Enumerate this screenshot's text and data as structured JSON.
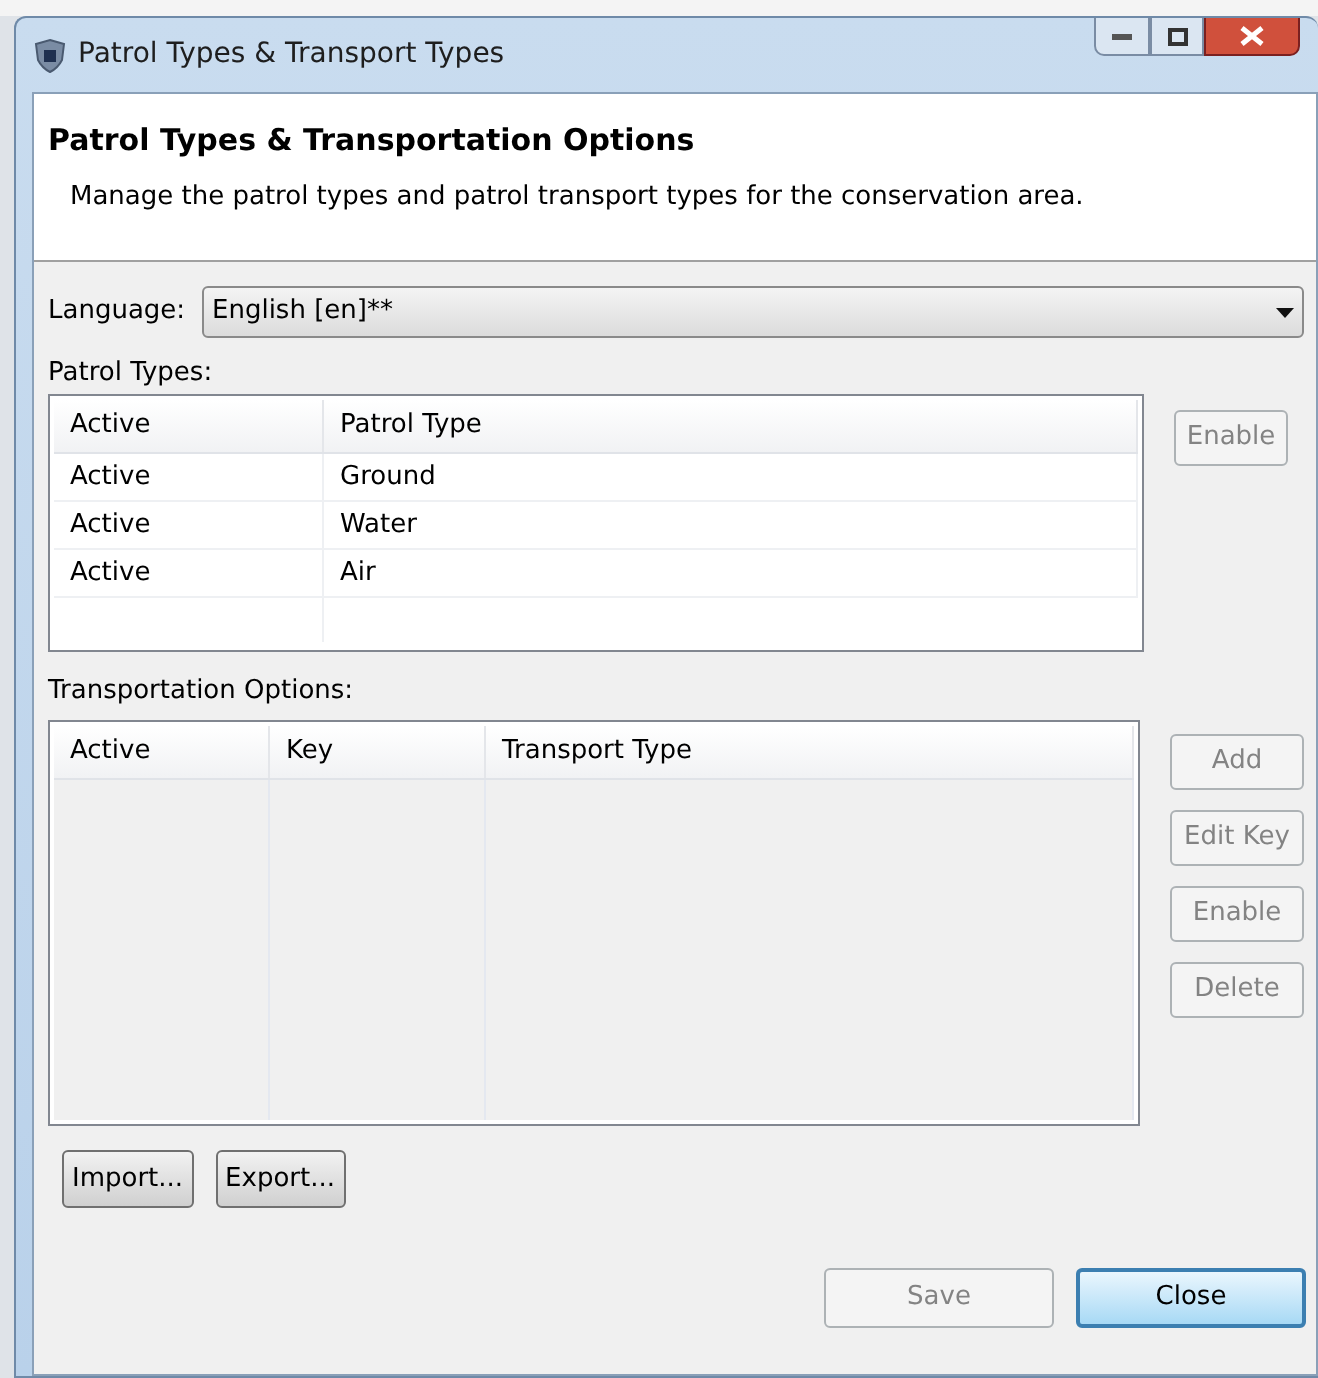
{
  "window": {
    "title": "Patrol Types & Transport Types"
  },
  "header": {
    "title": "Patrol Types & Transportation Options",
    "description": "Manage the patrol types and patrol transport types for the conservation area."
  },
  "language": {
    "label": "Language:",
    "value": "English [en]**"
  },
  "patrol_types": {
    "label": "Patrol Types:",
    "columns": [
      "Active",
      "Patrol Type"
    ],
    "rows": [
      [
        "Active",
        "Ground"
      ],
      [
        "Active",
        "Water"
      ],
      [
        "Active",
        "Air"
      ]
    ],
    "buttons": [
      {
        "label": "Enable",
        "disabled": true
      }
    ]
  },
  "transportation_options": {
    "label": "Transportation Options:",
    "columns": [
      "Active",
      "Key",
      "Transport Type"
    ],
    "buttons": [
      {
        "label": "Add",
        "disabled": true
      },
      {
        "label": "Edit Key",
        "disabled": true
      },
      {
        "label": "Enable",
        "disabled": true
      },
      {
        "label": "Delete",
        "disabled": true
      }
    ]
  },
  "io_buttons": [
    {
      "label": "Import...",
      "disabled": false
    },
    {
      "label": "Export...",
      "disabled": false
    }
  ],
  "footer_buttons": [
    {
      "label": "Save",
      "disabled": true,
      "default": false
    },
    {
      "label": "Close",
      "disabled": false,
      "default": true
    }
  ]
}
